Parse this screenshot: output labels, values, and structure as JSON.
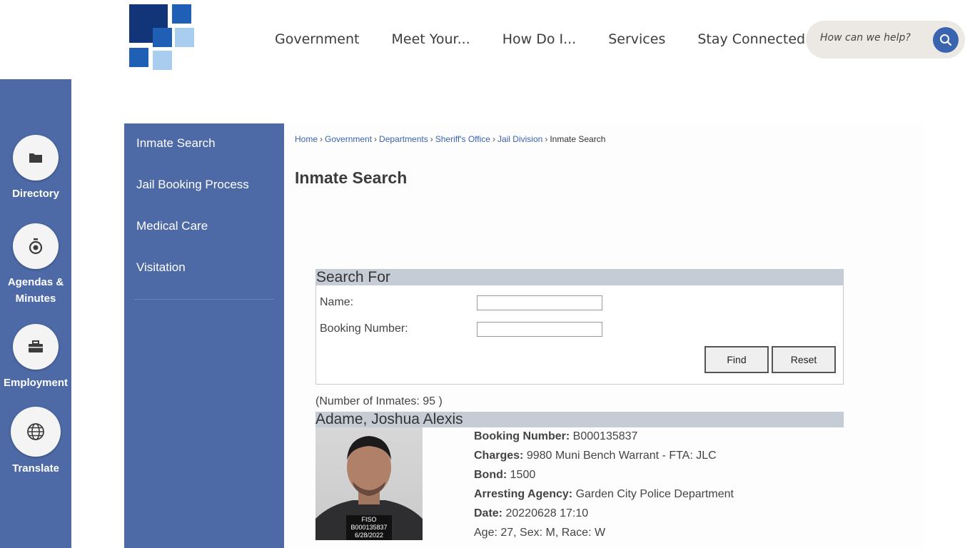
{
  "header": {
    "nav": [
      "Government",
      "Meet Your...",
      "How Do I...",
      "Services",
      "Stay Connected"
    ],
    "search_placeholder": "How can we help?"
  },
  "rail": {
    "items": [
      {
        "label": "Directory",
        "icon": "folder-icon"
      },
      {
        "label": "Agendas & Minutes",
        "icon": "stopwatch-icon"
      },
      {
        "label": "Employment",
        "icon": "briefcase-icon"
      },
      {
        "label": "Translate",
        "icon": "globe-icon"
      }
    ]
  },
  "sidemenu": {
    "items": [
      "Inmate Search",
      "Jail Booking Process",
      "Medical Care",
      "Visitation"
    ]
  },
  "breadcrumb": {
    "links": [
      "Home",
      "Government",
      "Departments",
      "Sheriff's Office",
      "Jail Division"
    ],
    "current": "Inmate Search",
    "separator": "›"
  },
  "page": {
    "title": "Inmate Search"
  },
  "search_form": {
    "header": "Search For",
    "name_label": "Name:",
    "name_value": "",
    "booking_label": "Booking Number:",
    "booking_value": "",
    "find_label": "Find",
    "reset_label": "Reset"
  },
  "results": {
    "count_text": "(Number of Inmates: 95 )",
    "inmates": [
      {
        "name": "Adame, Joshua Alexis",
        "placard": [
          "FISO",
          "B000135837",
          "6/28/2022"
        ],
        "booking_number_label": "Booking Number:",
        "booking_number": "B000135837",
        "charges_label": "Charges:",
        "charges": "9980 Muni Bench Warrant - FTA: JLC",
        "bond_label": "Bond:",
        "bond": "1500",
        "agency_label": "Arresting Agency:",
        "agency": "Garden City Police Department",
        "date_label": "Date:",
        "date": "20220628 17:10",
        "demographics": "Age: 27, Sex: M, Race: W"
      }
    ]
  },
  "colors": {
    "brand_blue": "#4d6aa6",
    "accent_blue": "#3a63b0",
    "logo_dark": "#12357a",
    "logo_mid": "#1f5fb6",
    "logo_light": "#a8cdee",
    "table_header": "#c6ccd6"
  }
}
